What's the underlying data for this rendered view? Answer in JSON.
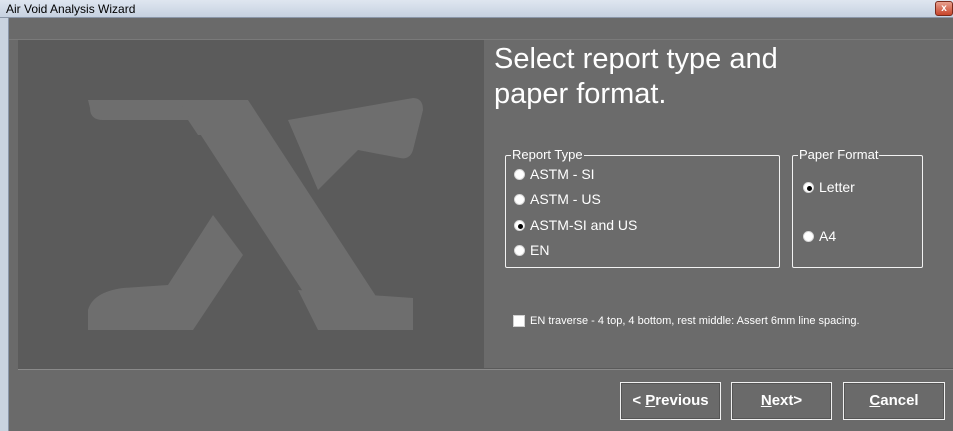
{
  "window": {
    "title": "Air Void Analysis Wizard",
    "close_label": "x"
  },
  "page": {
    "heading_line1": "Select report type and",
    "heading_line2": "paper format."
  },
  "report_type": {
    "legend": "Report Type",
    "options": [
      {
        "label": "ASTM - SI",
        "checked": false
      },
      {
        "label": "ASTM - US",
        "checked": false
      },
      {
        "label": "ASTM-SI and US",
        "checked": true
      },
      {
        "label": "EN",
        "checked": false
      }
    ]
  },
  "paper_format": {
    "legend": "Paper Format",
    "options": [
      {
        "label": "Letter",
        "checked": true
      },
      {
        "label": "A4",
        "checked": false
      }
    ]
  },
  "options": {
    "en_traverse_label": "EN traverse - 4 top, 4 bottom, rest middle: Assert 6mm line spacing.",
    "en_traverse_checked": false
  },
  "buttons": {
    "previous_prefix": "< ",
    "previous_accel": "P",
    "previous_rest": "revious",
    "next_accel": "N",
    "next_rest": "ext>",
    "cancel_accel": "C",
    "cancel_rest": "ancel"
  },
  "colors": {
    "background": "#6a6a6a",
    "graphic_panel": "#5b5b5b",
    "logo": "#6e6e6e",
    "text": "#ffffff"
  },
  "icons": {
    "logo": "x-logo-icon",
    "close": "close-icon"
  }
}
